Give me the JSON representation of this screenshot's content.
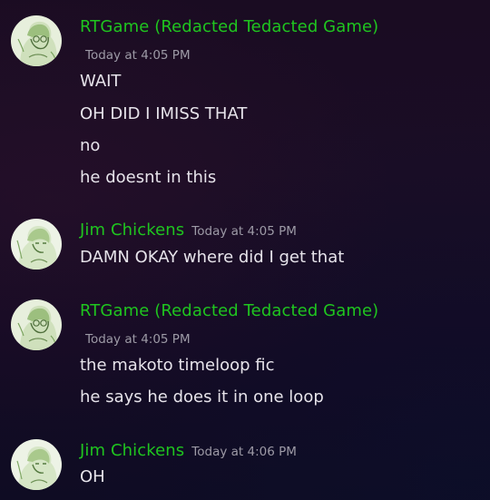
{
  "messages": [
    {
      "author": "RTGame (Redacted Tedacted Game)",
      "timestamp": "Today at 4:05 PM",
      "avatar_icon": "avatar-illustrated-character-icon",
      "lines": [
        "WAIT",
        "OH DID I IMISS THAT",
        "no",
        "he doesnt in this"
      ]
    },
    {
      "author": "Jim Chickens",
      "timestamp": "Today at 4:05 PM",
      "avatar_icon": "avatar-illustrated-character-icon",
      "lines": [
        "DAMN OKAY where did I get that"
      ]
    },
    {
      "author": "RTGame (Redacted Tedacted Game)",
      "timestamp": "Today at 4:05 PM",
      "avatar_icon": "avatar-illustrated-character-icon",
      "lines": [
        "the makoto timeloop fic",
        "he says he does it in one loop"
      ]
    },
    {
      "author": "Jim Chickens",
      "timestamp": "Today at 4:06 PM",
      "avatar_icon": "avatar-illustrated-character-icon",
      "lines": [
        "OH"
      ]
    }
  ],
  "colors": {
    "username": "#1fc51f",
    "timestamp": "#9d9aa6",
    "message_text": "#e6e3ea",
    "background": "#1a0c22"
  }
}
